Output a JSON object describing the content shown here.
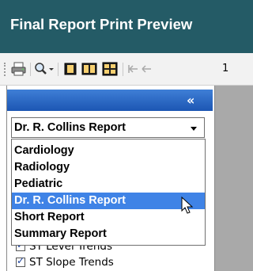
{
  "window": {
    "title": "Final Report Print Preview"
  },
  "toolbar": {
    "page_number": "1",
    "icons": [
      "print-icon",
      "zoom-icon",
      "single-page-icon",
      "two-page-icon",
      "four-page-icon",
      "first-page-icon",
      "previous-page-icon"
    ]
  },
  "panel": {
    "collapse_label": "«",
    "report_select": {
      "selected": "Dr. R. Collins Report",
      "options": [
        "Cardiology",
        "Radiology",
        "Pediatric",
        "Dr. R. Collins Report",
        "Short Report",
        "Summary Report"
      ],
      "highlighted_index": 3
    },
    "checkboxes": [
      {
        "label": "ST Level Trends",
        "checked": true
      },
      {
        "label": "ST Slope Trends",
        "checked": true
      }
    ]
  },
  "colors": {
    "title_bar": "#245b66",
    "panel_header": "#2a67c4",
    "selection": "#3f83e6",
    "preview_background": "#a9a9a9"
  }
}
